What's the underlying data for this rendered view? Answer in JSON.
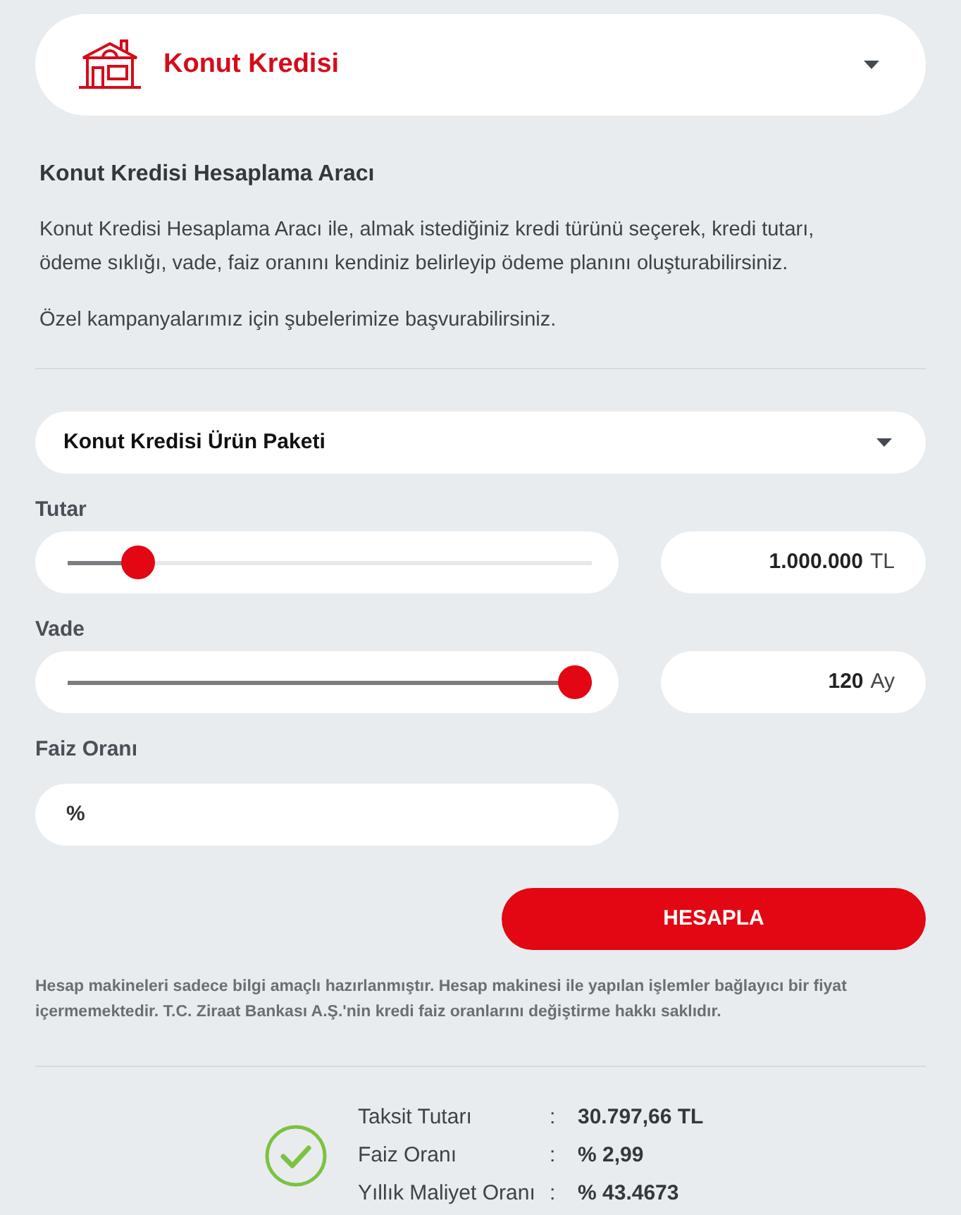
{
  "product_select": {
    "title": "Konut Kredisi"
  },
  "intro": {
    "heading": "Konut Kredisi Hesaplama Aracı",
    "paragraphs": [
      "Konut Kredisi Hesaplama Aracı ile, almak istediğiniz kredi türünü seçerek, kredi tutarı, ödeme sıklığı, vade, faiz oranını kendiniz belirleyip ödeme planını oluşturabilirsiniz.",
      "Özel kampanyalarımız için şubelerimize başvurabilirsiniz."
    ]
  },
  "form": {
    "package_select": {
      "value": "Konut Kredisi Ürün Paketi"
    },
    "sliders": [
      {
        "label": "Tutar",
        "level": 0.11,
        "value": "1.000.000",
        "unit": "TL"
      },
      {
        "label": "Vade",
        "level": 1,
        "value": "120",
        "unit": "Ay"
      }
    ],
    "rate_field": {
      "label": "Faiz Oranı",
      "prefix": "%"
    },
    "submit_button": {
      "label": "HESAPLA"
    }
  },
  "disclaimer": "Hesap makineleri sadece bilgi amaçlı hazırlanmıştır. Hesap makinesi ile yapılan işlemler bağlayıcı bir fiyat içermemektedir. T.C. Ziraat Bankası A.Ş.'nin kredi faiz oranlarını değiştirme hakkı saklıdır.",
  "results": {
    "rows": [
      {
        "label": "Taksit Tutarı",
        "separator": ":",
        "value": "30.797,66 TL"
      },
      {
        "label": "Faiz Oranı",
        "separator": ":",
        "value": "% 2,99"
      },
      {
        "label": "Yıllık Maliyet Oranı",
        "separator": ":",
        "value": "% 43.4673"
      }
    ]
  }
}
